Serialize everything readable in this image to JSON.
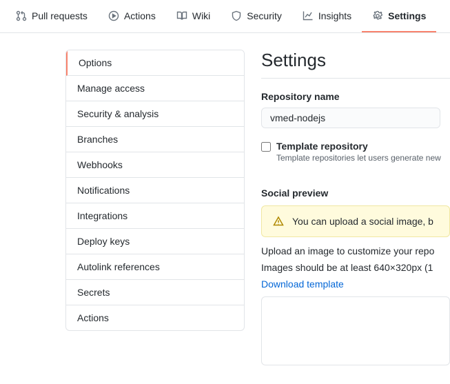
{
  "tabs": {
    "pull_requests": "Pull requests",
    "actions": "Actions",
    "wiki": "Wiki",
    "security": "Security",
    "insights": "Insights",
    "settings": "Settings"
  },
  "sidebar": {
    "items": [
      "Options",
      "Manage access",
      "Security & analysis",
      "Branches",
      "Webhooks",
      "Notifications",
      "Integrations",
      "Deploy keys",
      "Autolink references",
      "Secrets",
      "Actions"
    ]
  },
  "page": {
    "heading": "Settings",
    "repo_name_label": "Repository name",
    "repo_name_value": "vmed-nodejs",
    "template_checkbox_label": "Template repository",
    "template_checkbox_desc": "Template repositories let users generate new",
    "social_preview_heading": "Social preview",
    "social_warning": "You can upload a social image, b",
    "upload_hint": "Upload an image to customize your repo",
    "image_size_hint": "Images should be at least 640×320px (1",
    "download_template": "Download template"
  }
}
